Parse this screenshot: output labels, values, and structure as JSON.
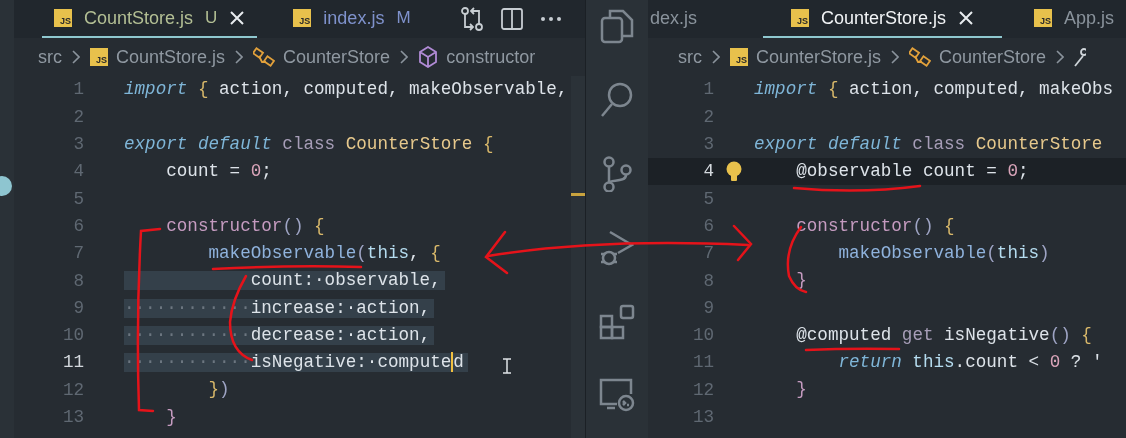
{
  "left_editor": {
    "tabs": [
      {
        "icon_text": "JS",
        "label": "CountStore.js",
        "badge": "U",
        "untracked": true,
        "modified": false,
        "selected": true,
        "closable": true
      },
      {
        "icon_text": "JS",
        "label": "index.js",
        "badge": "M",
        "untracked": false,
        "modified": true,
        "selected": false,
        "closable": false
      }
    ],
    "breadcrumb": [
      {
        "kind": "folder",
        "text": "src"
      },
      {
        "kind": "file",
        "icon_text": "JS",
        "text": "CountStore.js"
      },
      {
        "kind": "class",
        "text": "CounterStore"
      },
      {
        "kind": "method",
        "text": "constructor"
      }
    ],
    "lines": [
      {
        "number": "1",
        "tokens": [
          {
            "kind": "kw",
            "text": "import"
          },
          {
            "kind": "brace",
            "text": " {"
          },
          {
            "kind": "id",
            "text": " action, computed, makeObservable,"
          }
        ]
      },
      {
        "number": "2"
      },
      {
        "number": "3",
        "tokens": [
          {
            "kind": "kw",
            "text": "export default"
          },
          {
            "kind": "cls",
            "text": " class"
          },
          {
            "kind": "type",
            "text": " CounterStore"
          },
          {
            "kind": "brace",
            "text": " {"
          }
        ]
      },
      {
        "number": "4",
        "tokens": [
          {
            "kind": "id",
            "text": "    count = "
          },
          {
            "kind": "num",
            "text": "0"
          },
          {
            "kind": "id",
            "text": ";"
          }
        ]
      },
      {
        "number": "5"
      },
      {
        "number": "6",
        "tokens": [
          {
            "kind": "ctor",
            "text": "    constructor"
          },
          {
            "kind": "paren",
            "text": "()"
          },
          {
            "kind": "brace",
            "text": " {"
          }
        ]
      },
      {
        "number": "7",
        "tokens": [
          {
            "kind": "fn",
            "text": "        makeObservable"
          },
          {
            "kind": "paren",
            "text": "("
          },
          {
            "kind": "this",
            "text": "this"
          },
          {
            "kind": "id",
            "text": ","
          },
          {
            "kind": "brace",
            "text": " {"
          }
        ]
      },
      {
        "number": "8",
        "selected": true,
        "tokens": [
          {
            "kind": "id",
            "text": "            count:·observable,"
          }
        ]
      },
      {
        "number": "9",
        "selected": true,
        "tokens": [
          {
            "kind": "ws",
            "text": "············"
          },
          {
            "kind": "id",
            "text": "increase:·action,"
          }
        ]
      },
      {
        "number": "10",
        "selected": true,
        "tokens": [
          {
            "kind": "ws",
            "text": "············"
          },
          {
            "kind": "id",
            "text": "decrease:·action,"
          }
        ]
      },
      {
        "number": "11",
        "selected": true,
        "current": true,
        "tokens": [
          {
            "kind": "ws",
            "text": "············"
          },
          {
            "kind": "id",
            "text": "isNegative:·compute"
          },
          {
            "kind": "id",
            "text": "d",
            "caret": true
          }
        ]
      },
      {
        "number": "12",
        "tokens": [
          {
            "kind": "brace",
            "text": "        }"
          },
          {
            "kind": "paren",
            "text": ")"
          }
        ]
      },
      {
        "number": "13",
        "tokens": [
          {
            "kind": "ctor",
            "text": "    }"
          }
        ]
      }
    ]
  },
  "right_editor": {
    "tabs": [
      {
        "label": "dex.js",
        "selected": false,
        "closable": false
      },
      {
        "icon_text": "JS",
        "label": "CounterStore.js",
        "selected": true,
        "closable": true
      },
      {
        "icon_text": "JS",
        "label": "App.js",
        "selected": false,
        "closable": false
      }
    ],
    "breadcrumb": [
      {
        "kind": "folder",
        "text": "src"
      },
      {
        "kind": "file",
        "icon_text": "JS",
        "text": "CounterStore.js"
      },
      {
        "kind": "class",
        "text": "CounterStore"
      }
    ],
    "lines": [
      {
        "number": "1",
        "tokens": [
          {
            "kind": "kw",
            "text": "import"
          },
          {
            "kind": "brace",
            "text": " {"
          },
          {
            "kind": "id",
            "text": " action, computed, makeObs"
          }
        ]
      },
      {
        "number": "2"
      },
      {
        "number": "3",
        "tokens": [
          {
            "kind": "kw",
            "text": "export default"
          },
          {
            "kind": "cls",
            "text": " class"
          },
          {
            "kind": "type",
            "text": " CounterStore"
          }
        ]
      },
      {
        "number": "4",
        "current": true,
        "lightbulb": true,
        "tokens": [
          {
            "kind": "id",
            "text": "    @observable count = "
          },
          {
            "kind": "num",
            "text": "0"
          },
          {
            "kind": "id",
            "text": ";"
          }
        ]
      },
      {
        "number": "5"
      },
      {
        "number": "6",
        "tokens": [
          {
            "kind": "ctor",
            "text": "    constructor"
          },
          {
            "kind": "paren",
            "text": "()"
          },
          {
            "kind": "brace",
            "text": " {"
          }
        ]
      },
      {
        "number": "7",
        "tokens": [
          {
            "kind": "fn",
            "text": "        makeObservable"
          },
          {
            "kind": "paren",
            "text": "("
          },
          {
            "kind": "this",
            "text": "this"
          },
          {
            "kind": "paren",
            "text": ")"
          }
        ]
      },
      {
        "number": "8",
        "tokens": [
          {
            "kind": "ctor",
            "text": "    }"
          }
        ]
      },
      {
        "number": "9"
      },
      {
        "number": "10",
        "tokens": [
          {
            "kind": "id",
            "text": "    @computed"
          },
          {
            "kind": "cls",
            "text": " get"
          },
          {
            "kind": "id",
            "text": " isNegative"
          },
          {
            "kind": "paren",
            "text": "()"
          },
          {
            "kind": "brace",
            "text": " {"
          }
        ]
      },
      {
        "number": "11",
        "tokens": [
          {
            "kind": "kw",
            "text": "        return"
          },
          {
            "kind": "this",
            "text": " this"
          },
          {
            "kind": "id",
            "text": ".count < "
          },
          {
            "kind": "num",
            "text": "0"
          },
          {
            "kind": "id",
            "text": " ? '"
          }
        ]
      },
      {
        "number": "12",
        "tokens": [
          {
            "kind": "ctor",
            "text": "    }"
          }
        ]
      },
      {
        "number": "13"
      }
    ]
  }
}
